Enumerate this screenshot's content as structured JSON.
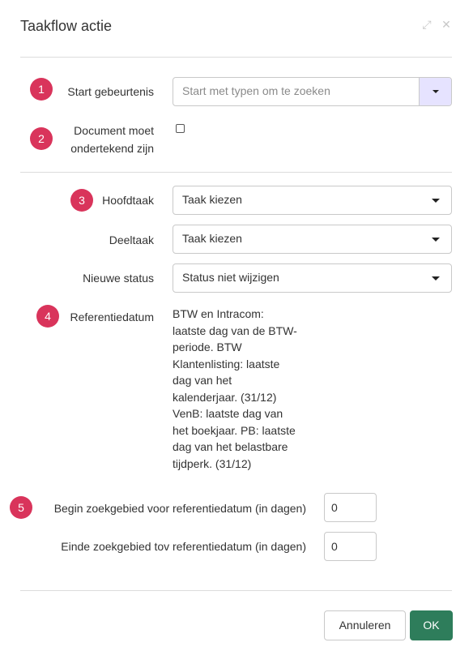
{
  "dialog": {
    "title": "Taakflow actie",
    "expand_icon": "expand-icon",
    "close_icon": "close-icon"
  },
  "steps": [
    "1",
    "2",
    "3",
    "4",
    "5"
  ],
  "start_event": {
    "label": "Start gebeurtenis",
    "placeholder": "Start met typen om te zoeken"
  },
  "signed": {
    "label_line1": "Document moet",
    "label_line2": "ondertekend zijn",
    "checked": false
  },
  "main_task": {
    "label": "Hoofdtaak",
    "value": "Taak kiezen"
  },
  "sub_task": {
    "label": "Deeltaak",
    "value": "Taak kiezen"
  },
  "new_status": {
    "label": "Nieuwe status",
    "value": "Status niet wijzigen"
  },
  "reference_date": {
    "label": "Referentiedatum",
    "lines": [
      "BTW en Intracom:",
      "laatste dag van de BTW-",
      "periode. BTW",
      "Klantenlisting: laatste",
      "dag van het",
      "kalenderjaar. (31/12)",
      "VenB: laatste dag van",
      "het boekjaar. PB: laatste",
      "dag van het belastbare",
      "tijdperk. (31/12)"
    ]
  },
  "search_start": {
    "label": "Begin zoekgebied voor referentiedatum (in dagen)",
    "value": "0"
  },
  "search_end": {
    "label": "Einde zoekgebied tov referentiedatum (in dagen)",
    "value": "0"
  },
  "footer": {
    "cancel_label": "Annuleren",
    "ok_label": "OK"
  },
  "colors": {
    "badge": "#d9345b",
    "ok_button": "#2e7d5b",
    "search_addon": "#e6e3ff"
  }
}
